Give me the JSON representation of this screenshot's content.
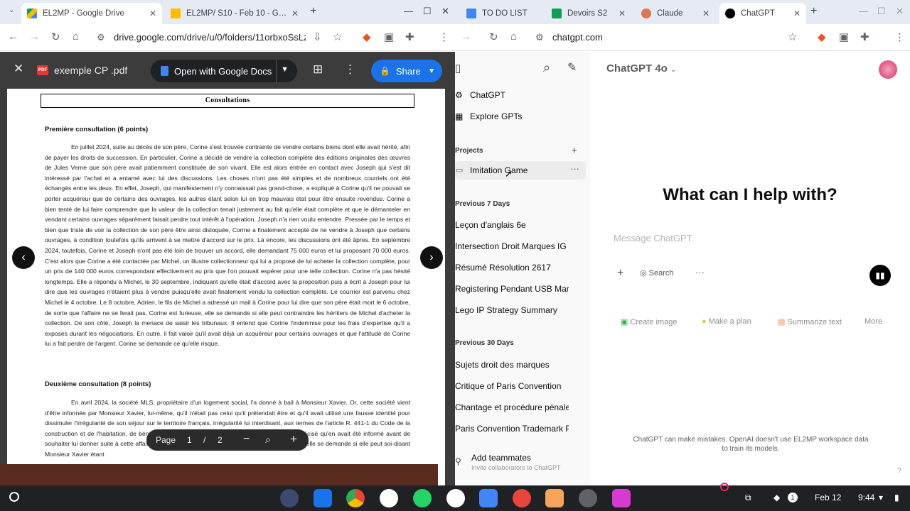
{
  "left_browser": {
    "tabs": [
      {
        "title": "EL2MP - Google Drive",
        "active": true
      },
      {
        "title": "EL2MP/ S10 - Feb 10 - Googl",
        "active": false
      }
    ],
    "url": "drive.google.com/drive/u/0/folders/11orbxoSsLzy",
    "viewer": {
      "filename": "exemple CP .pdf",
      "open_with": "Open with Google Docs",
      "share": "Share",
      "page_label": "Page",
      "page_current": "1",
      "page_sep": "/",
      "page_total": "2"
    },
    "document": {
      "header": "Consultations",
      "section1_title": "Première consultation (6 points)",
      "section1_text": "En juillet 2024, suite au décès de son père, Corine s'est trouvée contrainte de vendre certains biens dont elle avait hérité, afin de payer les droits de succession. En particulier, Corine a décidé de vendre la collection complète des éditions originales des œuvres de Jules Verne que son père avait patiemment constituée de son vivant. Elle est alors entrée en contact avec Joseph qui s'est dit intéressé par l'achat et a entamé avec lui des discussions. Les choses n'ont pas été simples et de nombreux courriels ont été échangés entre les deux. En effet, Joseph, qui manifestement n'y connaissait pas grand-chose, a expliqué à Corine qu'il ne pouvait se porter acquéreur que de certains des ouvrages, les autres étant selon lui en trop mauvais état pour être ensuite revendus. Corine a bien tenté de lui faire comprendre que la valeur de la collection tenait justement au fait qu'elle était complète et que le démanteler en vendant certains ouvrages séparément faisait perdre tout intérêt à l'opération, Joseph n'a rien voulu entendre. Pressée par le temps et bien que triste de voir la collection de son père être ainsi disloquée, Corine a finalement accepté de ne vendre à Joseph que certains ouvrages, à condition toutefois qu'ils arrivent à se mettre d'accord sur le prix. Là encore, les discussions ont été âpres. En septembre 2024, toutefois, Corine et Joseph n'ont pas été loin de trouver un accord, elle demandant 75 000 euros et lui proposant 70 000 euros. C'est alors que Corine a été contactée par Michel, un illustre collectionneur qui lui a proposé de lui acheter la collection complète, pour un prix de 140 000 euros correspondant effectivement au prix que l'on pouvait espérer pour une telle collection. Corine n'a pas hésité longtemps. Elle a répondu à Michel, le 30 septembre, indiquant qu'elle était d'accord avec la proposition puis a écrit à Joseph pour lui dire que les ouvrages n'étaient plus à vendre puisqu'elle avait finalement vendu la collection complète. Le courrier est parvenu chez Michel le 4 octobre. Le 8 octobre, Adrien, le fils de Michel a adressé un mail à Corine pour lui dire que son père était mort le 6 octobre, de sorte que l'affaire ne se ferait pas. Corine est furieuse, elle se demande si elle peut contraindre les héritiers de Michel d'acheter la collection. De son côté, Joseph la menace de saisir les tribunaux. Il entend que Corine l'indemnise pour les frais d'expertise qu'il a exposés durant les négociations. En outre, il fait valoir qu'il avait déjà un acquéreur pour certains ouvrages et que l'attitude de Corine lui a fait perdre de l'argent. Corine se demande ce qu'elle risque.",
      "section2_title": "Deuxième consultation (8 points)",
      "section2_text": "En avril 2024, la société MLS, propriétaire d'un logement social, l'a donné à bail à Monsieur Xavier. Or, cette société vient d'être informée par Monsieur Xavier, lui-même, qu'il n'était pas celui qu'il prétendait être et qu'il avait utilisé une fausse identité pour dissimuler l'irrégularité de son séjour sur le territoire français, irrégularité lui interdisant, aux termes de l'article R. 441-1 du Code de la construction et de l'habitation, de bénéficier d'un tel logement social. Monsieur Xavier lui a précisé qu'en avait été informé avant de souhaiter lui donner suite à cette affaire. La société MLS a été très surprise de cette révélation ; elle se demande si elle peut soi-disant Monsieur Xavier étant"
    }
  },
  "right_browser": {
    "tabs": [
      {
        "title": "TO DO LIST",
        "active": false
      },
      {
        "title": "Devoirs S2",
        "active": false
      },
      {
        "title": "Claude",
        "active": false
      },
      {
        "title": "ChatGPT",
        "active": true
      }
    ],
    "url": "chatgpt.com",
    "sidebar": {
      "top_items": [
        "ChatGPT",
        "Explore GPTs"
      ],
      "projects_label": "Projects",
      "project": "Imitation Game",
      "prev7_label": "Previous 7 Days",
      "prev7": [
        "Leçon d'anglais 6e",
        "Intersection Droit Marques IG",
        "Résumé Résolution 2617",
        "Registering Pendant USB Mark",
        "Lego IP Strategy Summary"
      ],
      "prev30_label": "Previous 30 Days",
      "prev30": [
        "Sujets droit des marques",
        "Critique of Paris Convention",
        "Chantage et procédure pénale",
        "Paris Convention Trademark Pr"
      ],
      "add_teammates": "Add teammates",
      "add_teammates_sub": "Invite collaborators to ChatGPT"
    },
    "main": {
      "model": "ChatGPT 4o",
      "hero": "What can I help with?",
      "placeholder": "Message ChatGPT",
      "search": "Search",
      "chips": [
        "Create image",
        "Make a plan",
        "Summarize text",
        "More"
      ],
      "disclaimer": "ChatGPT can make mistakes. OpenAI doesn't use EL2MP workspace data to train its models."
    }
  },
  "shelf": {
    "date": "Feb 12",
    "time": "9:44",
    "notif_count": "1"
  }
}
